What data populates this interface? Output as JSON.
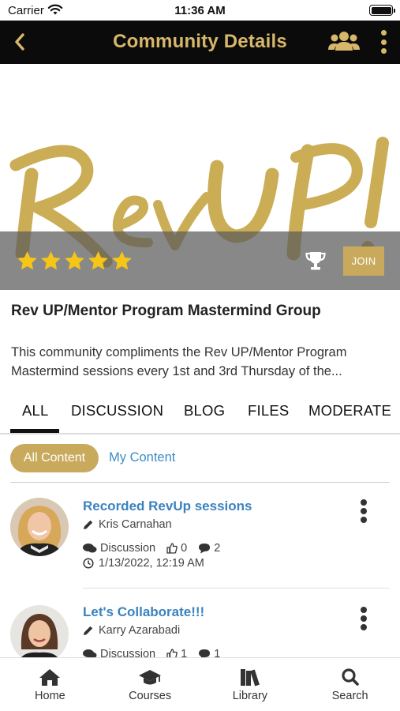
{
  "status_bar": {
    "carrier": "Carrier",
    "time": "11:36 AM"
  },
  "header": {
    "title": "Community Details",
    "back_icon": "chevron-left-icon",
    "members_icon": "users-icon",
    "more_icon": "vertical-dots-icon",
    "background_color": "#0b0b0b",
    "accent_color": "#d7b86a"
  },
  "banner": {
    "logo_text": "Rev UP!",
    "rating": 5,
    "rating_max": 5,
    "trophy_icon": "trophy-icon",
    "join_label": "JOIN"
  },
  "group": {
    "name": "Rev UP/Mentor Program Mastermind Group",
    "description_line1": "This community compliments the Rev UP/Mentor Program",
    "description_line2": "Mastermind sessions every 1st and 3rd Thursday of the..."
  },
  "tabs": [
    {
      "label": "ALL",
      "active": true
    },
    {
      "label": "DISCUSSION",
      "active": false
    },
    {
      "label": "BLOG",
      "active": false
    },
    {
      "label": "FILES",
      "active": false
    },
    {
      "label": "MODERATE",
      "active": false
    }
  ],
  "filters": {
    "all_content": "All Content",
    "my_content": "My Content"
  },
  "items": [
    {
      "title": "Recorded RevUp sessions",
      "author": "Kris Carnahan",
      "type": "Discussion",
      "likes": "0",
      "comments": "2",
      "date": "1/13/2022, 12:19 AM"
    },
    {
      "title": "Let's Collaborate!!!",
      "author": "Karry Azarabadi",
      "type": "Discussion",
      "likes": "1",
      "comments": "1"
    }
  ],
  "bottom_nav": [
    {
      "label": "Home",
      "icon": "home-icon"
    },
    {
      "label": "Courses",
      "icon": "graduation-cap-icon"
    },
    {
      "label": "Library",
      "icon": "books-icon"
    },
    {
      "label": "Search",
      "icon": "search-icon"
    }
  ],
  "colors": {
    "gold": "#c9aa5d",
    "link_blue": "#3b82c0"
  }
}
